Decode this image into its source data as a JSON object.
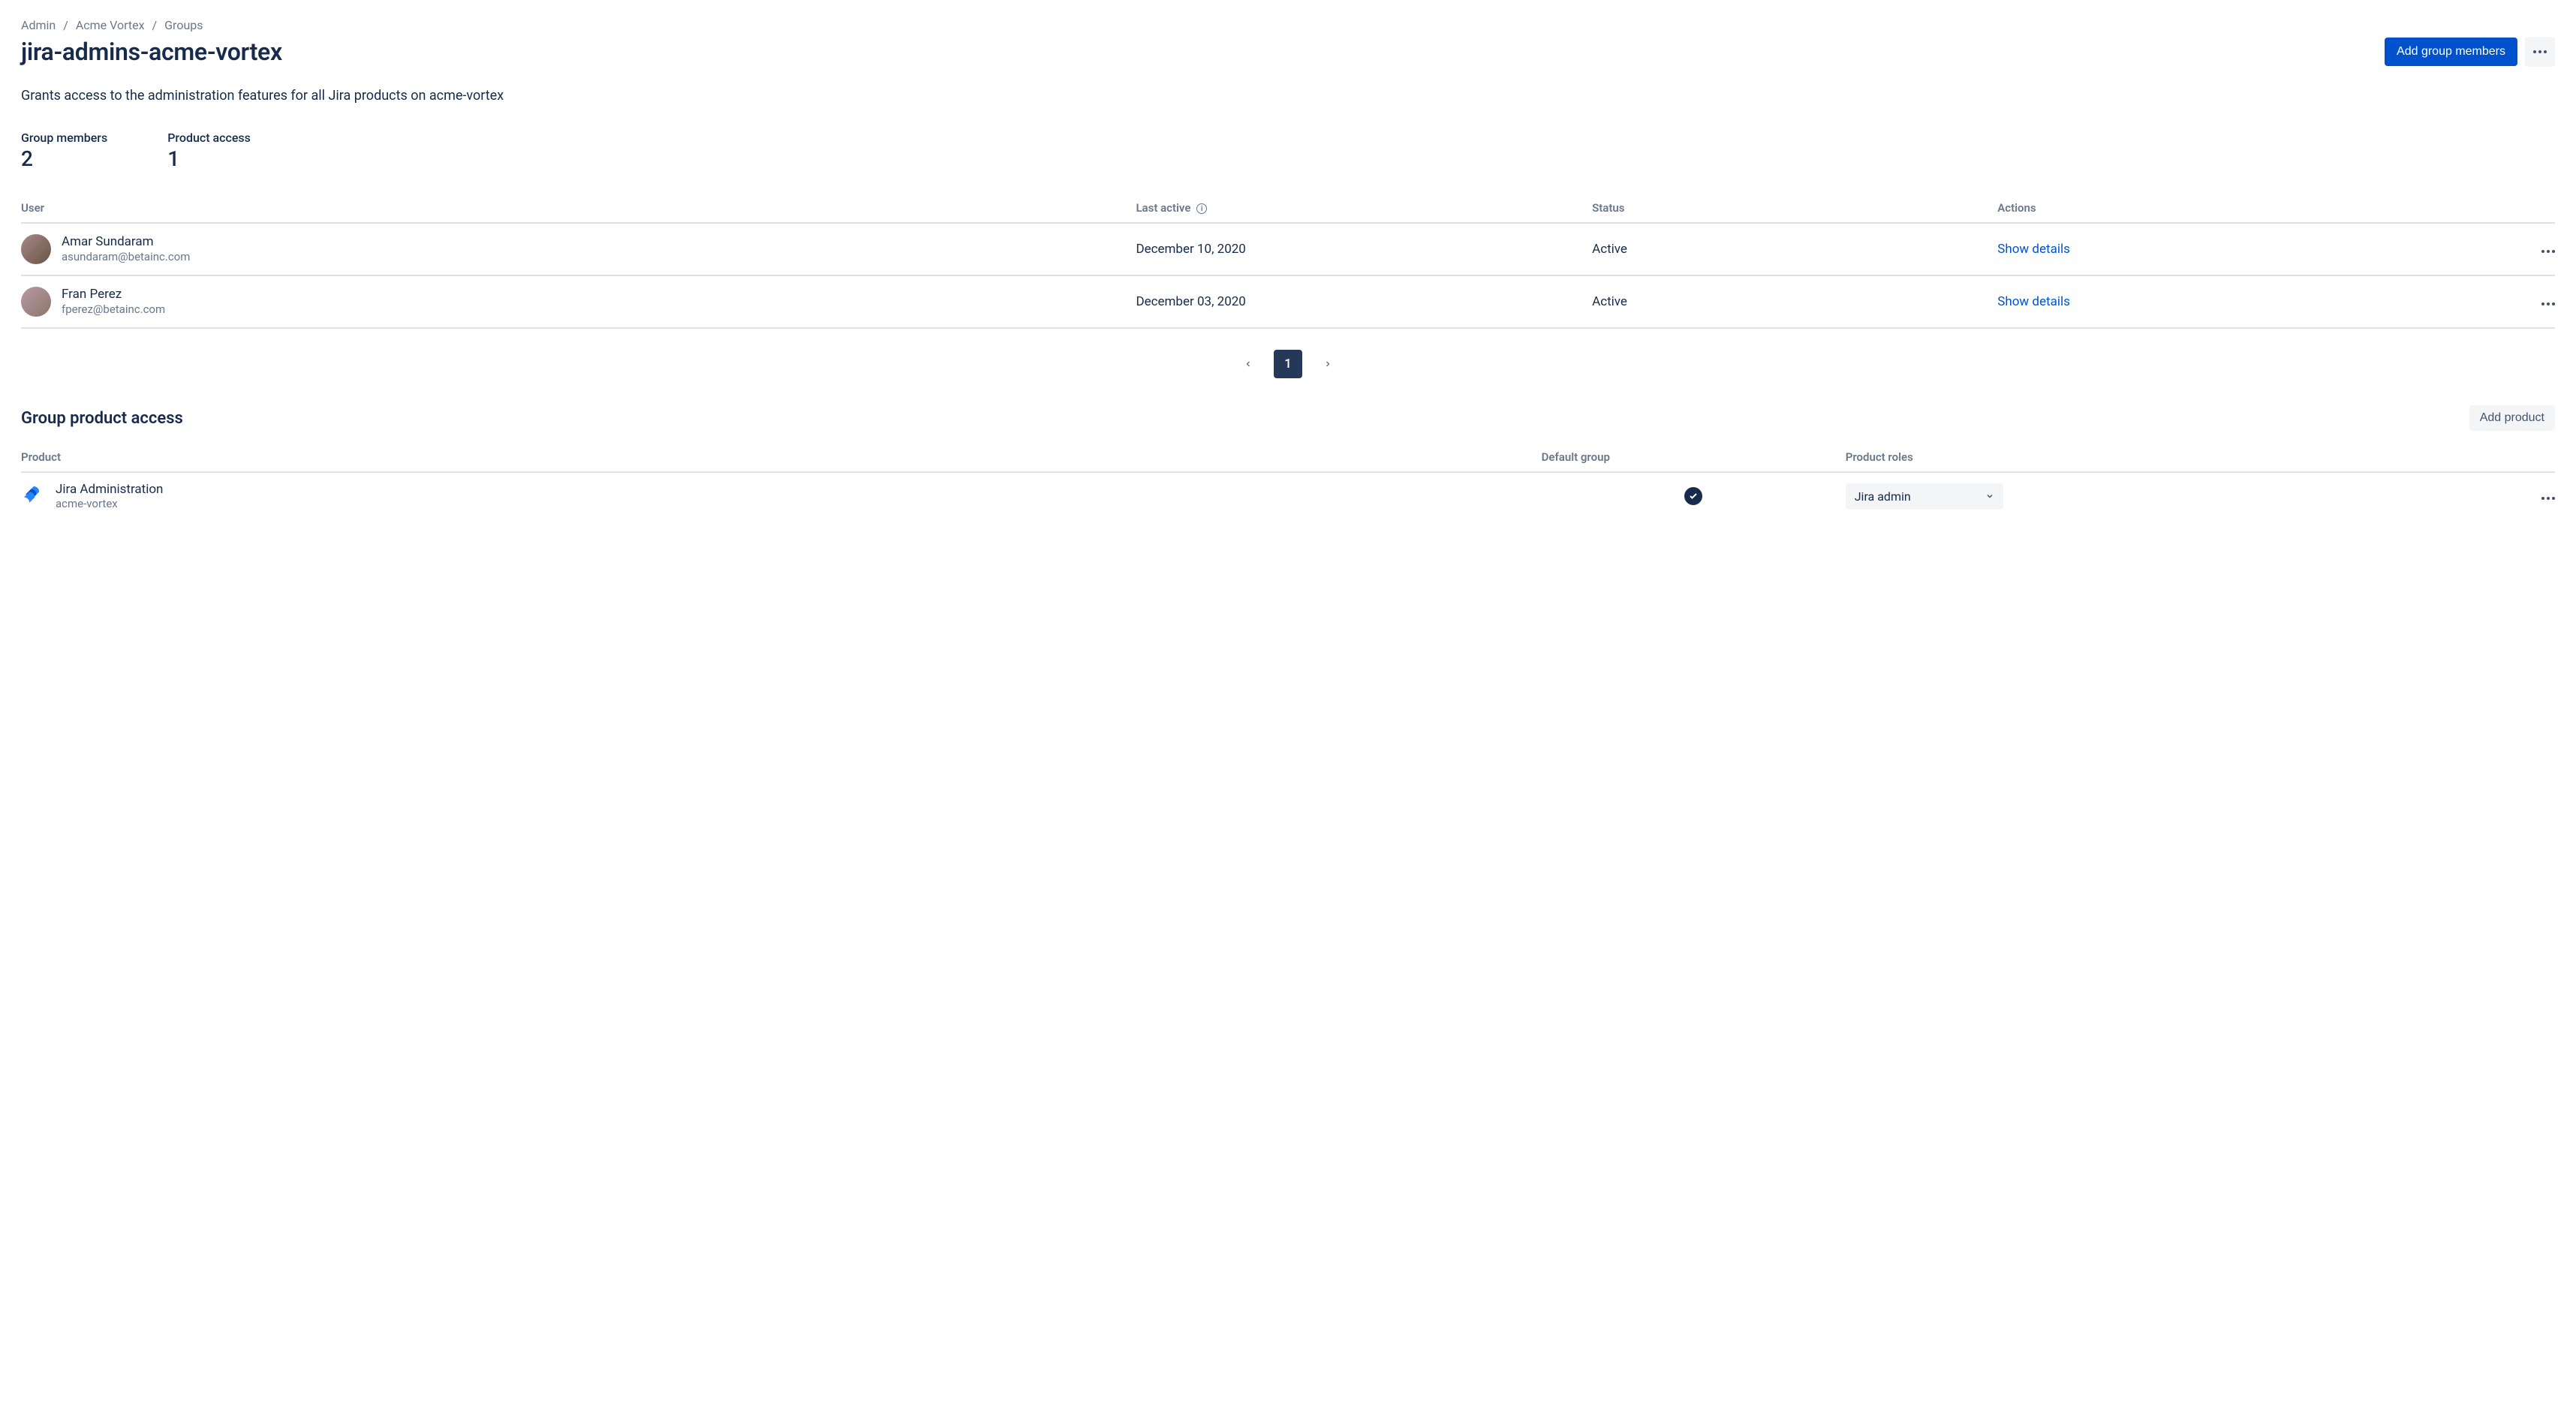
{
  "breadcrumb": [
    {
      "label": "Admin"
    },
    {
      "label": "Acme Vortex"
    },
    {
      "label": "Groups"
    }
  ],
  "page": {
    "title": "jira-admins-acme-vortex",
    "description": "Grants access to the administration features for all Jira products on acme-vortex",
    "add_members_label": "Add group members"
  },
  "stats": {
    "members_label": "Group members",
    "members_value": "2",
    "product_label": "Product access",
    "product_value": "1"
  },
  "users_table": {
    "headers": {
      "user": "User",
      "last_active": "Last active",
      "status": "Status",
      "actions": "Actions"
    },
    "rows": [
      {
        "name": "Amar Sundaram",
        "email": "asundaram@betainc.com",
        "last_active": "December 10, 2020",
        "status": "Active",
        "action": "Show details"
      },
      {
        "name": "Fran Perez",
        "email": "fperez@betainc.com",
        "last_active": "December 03, 2020",
        "status": "Active",
        "action": "Show details"
      }
    ]
  },
  "pagination": {
    "current": "1"
  },
  "product_access": {
    "title": "Group product access",
    "add_label": "Add product",
    "headers": {
      "product": "Product",
      "default_group": "Default group",
      "product_roles": "Product roles"
    },
    "rows": [
      {
        "name": "Jira Administration",
        "site": "acme-vortex",
        "default_group": true,
        "role": "Jira admin"
      }
    ]
  }
}
